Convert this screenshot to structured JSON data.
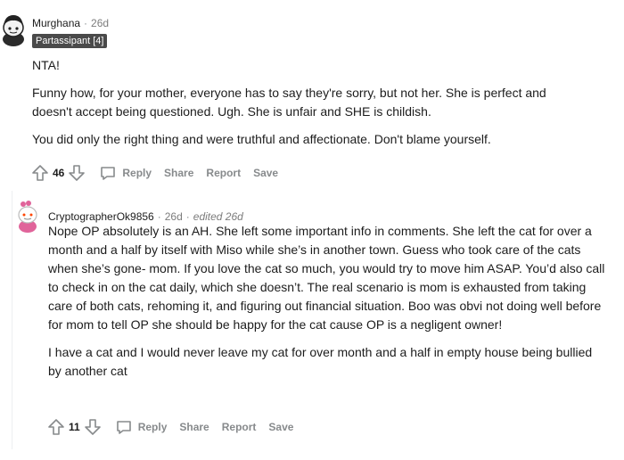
{
  "comments": [
    {
      "username": "Murghana",
      "time": "26d",
      "flair": "Partassipant [4]",
      "paragraphs": [
        "NTA!",
        "Funny how, for your mother, everyone has to say they're sorry, but not her. She is perfect and doesn't accept being questioned. Ugh. She is unfair and SHE is childish.",
        "You did only the right thing and were truthful and affectionate. Don't blame yourself."
      ],
      "score": "46",
      "actions": {
        "reply": "Reply",
        "share": "Share",
        "report": "Report",
        "save": "Save"
      }
    },
    {
      "username": "CryptographerOk9856",
      "time": "26d",
      "edited": "edited 26d",
      "paragraphs": [
        "Nope OP absolutely is an AH. She left some important info in comments. She left the cat for over a month and a half by itself with Miso while she’s in another town. Guess who took care of the cats when she’s gone- mom. If you love the cat so much, you would try to move him ASAP. You’d also call to check in on the cat daily, which she doesn’t. The real scenario is mom is exhausted from taking care of both cats, rehoming it, and figuring out financial situation. Boo was obvi not doing well before for mom to tell OP she should be happy for the cat cause OP is a negligent owner!",
        "I have a cat and I would never leave my cat for over month and a half in empty house being bullied by another cat"
      ],
      "score": "11",
      "actions": {
        "reply": "Reply",
        "share": "Share",
        "report": "Report",
        "save": "Save"
      }
    }
  ],
  "colors": {
    "text": "#1c1c1c",
    "meta": "#7c7c7c",
    "flair_bg": "#4a4a4a"
  },
  "icons": [
    "upvote-icon",
    "downvote-icon",
    "comment-bubble-icon"
  ]
}
